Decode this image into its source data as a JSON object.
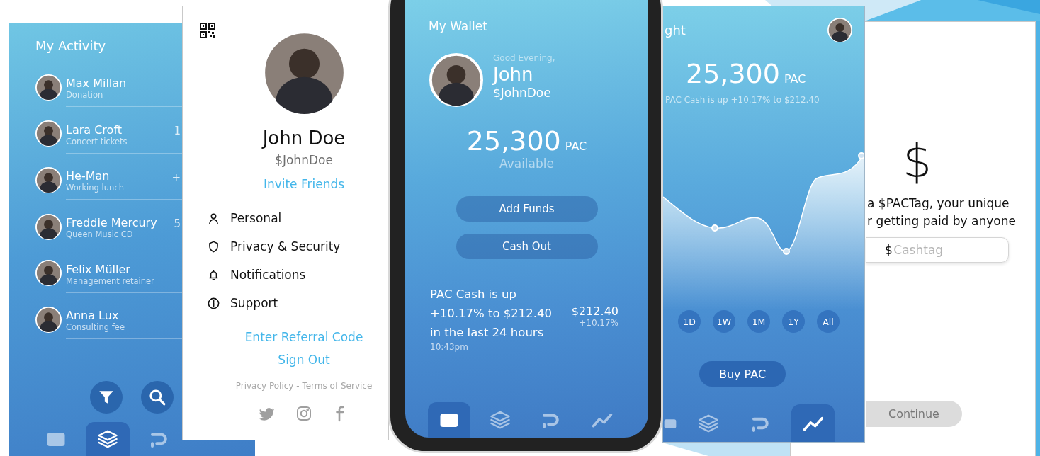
{
  "activity_screen": {
    "title": "My Activity",
    "items": [
      {
        "name": "Max Millan",
        "note": "Donation"
      },
      {
        "name": "Lara Croft",
        "note": "Concert tickets",
        "amount": "1"
      },
      {
        "name": "He-Man",
        "note": "Working lunch",
        "amount": "+"
      },
      {
        "name": "Freddie Mercury",
        "note": "Queen Music CD",
        "amount": "5"
      },
      {
        "name": "Felix Müller",
        "note": "Management retainer"
      },
      {
        "name": "Anna Lux",
        "note": "Consulting fee"
      }
    ],
    "actions": [
      {
        "kind": "filter"
      },
      {
        "kind": "search"
      }
    ],
    "nav": [
      {
        "kind": "wallet",
        "selected": false
      },
      {
        "kind": "layers",
        "selected": true
      },
      {
        "kind": "pay",
        "selected": false
      }
    ]
  },
  "profile_menu": {
    "name": "John Doe",
    "cashtag": "$JohnDoe",
    "invite": "Invite Friends",
    "items": [
      {
        "kind": "person",
        "label": "Personal"
      },
      {
        "kind": "shield",
        "label": "Privacy & Security"
      },
      {
        "kind": "bell",
        "label": "Notifications"
      },
      {
        "kind": "info",
        "label": "Support"
      }
    ],
    "referral": "Enter Referral Code",
    "sign_out": "Sign Out",
    "footer": "Privacy Policy - Terms of Service",
    "social": [
      {
        "kind": "bird"
      },
      {
        "kind": "camera"
      },
      {
        "kind": "letter-f"
      }
    ]
  },
  "wallet_screen": {
    "title": "My Wallet",
    "greeting": "Good Evening,",
    "first_name": "John",
    "cashtag": "$JohnDoe",
    "balance": "25,300",
    "unit": "PAC",
    "balance_label": "Available",
    "buttons": [
      "Add Funds",
      "Cash Out"
    ],
    "notice": {
      "lines": [
        "PAC Cash is up",
        "+10.17% to $212.40",
        "in the last 24 hours"
      ],
      "time": "10:43pm",
      "price": "$212.40",
      "change": "+10.17%"
    },
    "nav": [
      {
        "kind": "wallet",
        "selected": true
      },
      {
        "kind": "layers",
        "selected": false
      },
      {
        "kind": "pay",
        "selected": false
      },
      {
        "kind": "trend",
        "selected": false
      }
    ]
  },
  "chart_screen": {
    "title": "ght",
    "balance": "25,300",
    "unit": "PAC",
    "subtitle": "PAC Cash is up +10.17% to $212.40",
    "periods": [
      "1D",
      "1W",
      "1M",
      "1Y",
      "All"
    ],
    "button": "Buy PAC",
    "nav": [
      {
        "kind": "wallet",
        "selected": false
      },
      {
        "kind": "layers",
        "selected": false
      },
      {
        "kind": "pay",
        "selected": false
      },
      {
        "kind": "trend",
        "selected": true
      }
    ]
  },
  "cashtag_screen": {
    "symbol": "$",
    "lines": [
      "a $PACTag, your unique",
      "r getting paid by anyone"
    ],
    "field": {
      "prefix": "$",
      "placeholder": "Cashtag"
    },
    "button": {
      "label": "Continue",
      "disabled": true
    }
  }
}
